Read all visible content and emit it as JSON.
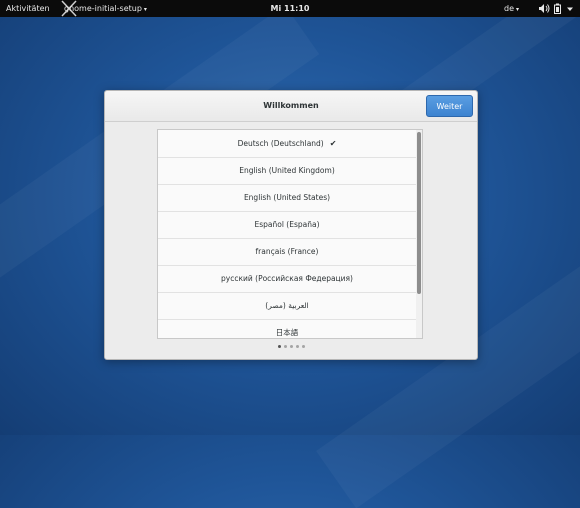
{
  "topbar": {
    "activities": "Aktivitäten",
    "app_menu": "gnome-initial-setup",
    "app_menu_caret": "▾",
    "clock": "Mi 11:10",
    "language": "de",
    "language_caret": "▾",
    "icons": [
      "volume-icon",
      "battery-icon",
      "system-menu-caret-icon"
    ]
  },
  "dialog": {
    "title": "Willkommen",
    "next_button": "Weiter",
    "languages": [
      "Deutsch (Deutschland)",
      "English (United Kingdom)",
      "English (United States)",
      "Español (España)",
      "français (France)",
      "русский (Российская Федерация)",
      "العربية (مصر)",
      "日本語"
    ],
    "selected_index": 0,
    "selected_mark": "✔",
    "page_count": 5,
    "current_page": 0
  },
  "colors": {
    "accent": "#3d83d0",
    "topbar": "#0b0b0b",
    "desktop": "#1f5598"
  }
}
